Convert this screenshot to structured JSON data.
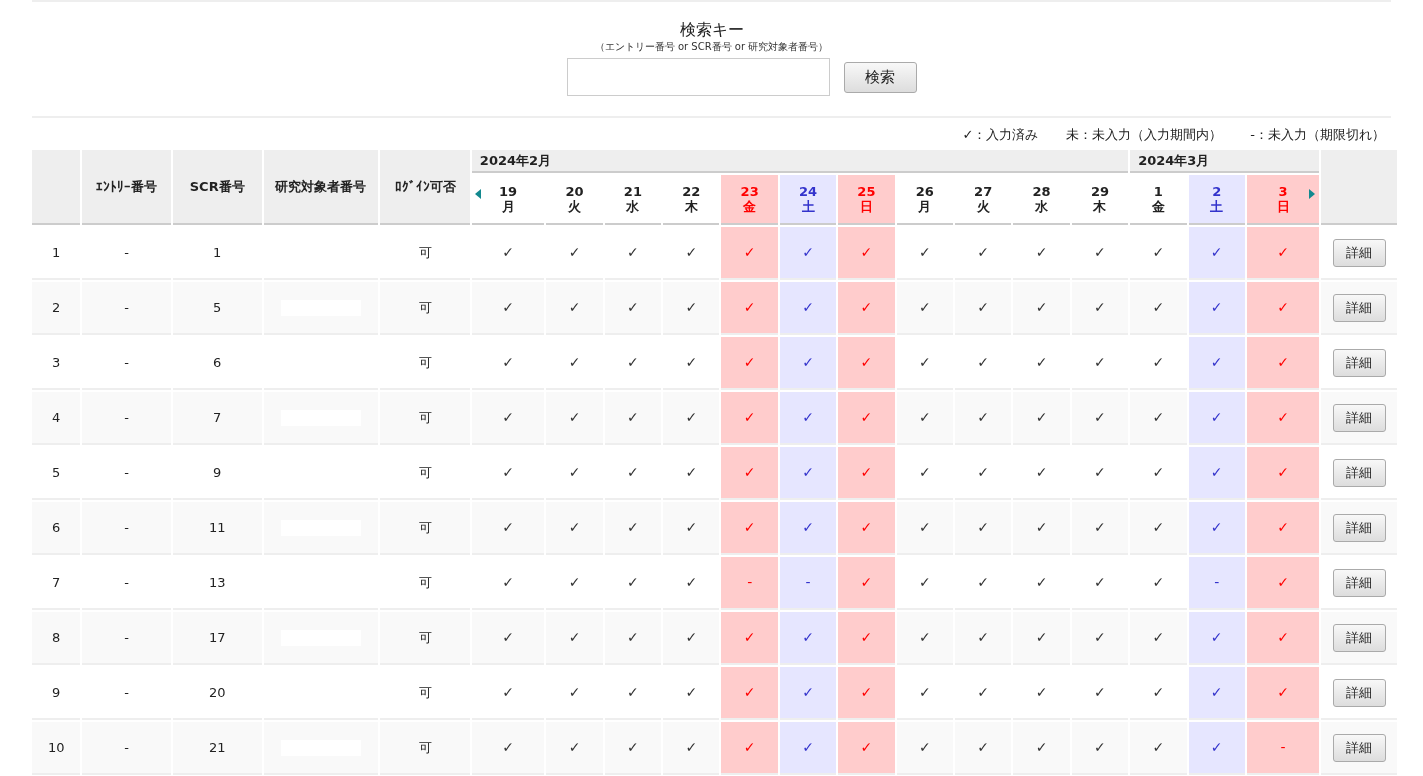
{
  "search": {
    "label": "検索キー",
    "hint": "（エントリー番号 or SCR番号 or 研究対象者番号）",
    "button": "検索"
  },
  "legend": [
    "✓：入力済み",
    "未：未入力（入力期間内）",
    "-：未入力（期限切れ）"
  ],
  "table": {
    "columns": [
      "ｴﾝﾄﾘｰ番号",
      "SCR番号",
      "研究対象者番号",
      "ﾛｸﾞｲﾝ可否"
    ],
    "months": [
      {
        "label": "2024年2月",
        "days": [
          {
            "day": "19",
            "weekday": "月",
            "kind": "weekday"
          },
          {
            "day": "20",
            "weekday": "火",
            "kind": "weekday"
          },
          {
            "day": "21",
            "weekday": "水",
            "kind": "weekday"
          },
          {
            "day": "22",
            "weekday": "木",
            "kind": "weekday"
          },
          {
            "day": "23",
            "weekday": "金",
            "kind": "holiday"
          },
          {
            "day": "24",
            "weekday": "土",
            "kind": "saturday"
          },
          {
            "day": "25",
            "weekday": "日",
            "kind": "holiday"
          },
          {
            "day": "26",
            "weekday": "月",
            "kind": "weekday"
          },
          {
            "day": "27",
            "weekday": "火",
            "kind": "weekday"
          },
          {
            "day": "28",
            "weekday": "水",
            "kind": "weekday"
          },
          {
            "day": "29",
            "weekday": "木",
            "kind": "weekday"
          }
        ]
      },
      {
        "label": "2024年3月",
        "days": [
          {
            "day": "1",
            "weekday": "金",
            "kind": "weekday"
          },
          {
            "day": "2",
            "weekday": "土",
            "kind": "saturday"
          },
          {
            "day": "3",
            "weekday": "日",
            "kind": "holiday"
          }
        ]
      }
    ],
    "rows": [
      {
        "no": "1",
        "entry": "-",
        "scr": "1",
        "redacted": false,
        "login": "可",
        "marks": [
          "✓",
          "✓",
          "✓",
          "✓",
          "✓",
          "✓",
          "✓",
          "✓",
          "✓",
          "✓",
          "✓",
          "✓",
          "✓",
          "✓"
        ],
        "action": "詳細"
      },
      {
        "no": "2",
        "entry": "-",
        "scr": "5",
        "redacted": true,
        "login": "可",
        "marks": [
          "✓",
          "✓",
          "✓",
          "✓",
          "✓",
          "✓",
          "✓",
          "✓",
          "✓",
          "✓",
          "✓",
          "✓",
          "✓",
          "✓"
        ],
        "action": "詳細"
      },
      {
        "no": "3",
        "entry": "-",
        "scr": "6",
        "redacted": false,
        "login": "可",
        "marks": [
          "✓",
          "✓",
          "✓",
          "✓",
          "✓",
          "✓",
          "✓",
          "✓",
          "✓",
          "✓",
          "✓",
          "✓",
          "✓",
          "✓"
        ],
        "action": "詳細"
      },
      {
        "no": "4",
        "entry": "-",
        "scr": "7",
        "redacted": true,
        "login": "可",
        "marks": [
          "✓",
          "✓",
          "✓",
          "✓",
          "✓",
          "✓",
          "✓",
          "✓",
          "✓",
          "✓",
          "✓",
          "✓",
          "✓",
          "✓"
        ],
        "action": "詳細"
      },
      {
        "no": "5",
        "entry": "-",
        "scr": "9",
        "redacted": false,
        "login": "可",
        "marks": [
          "✓",
          "✓",
          "✓",
          "✓",
          "✓",
          "✓",
          "✓",
          "✓",
          "✓",
          "✓",
          "✓",
          "✓",
          "✓",
          "✓"
        ],
        "action": "詳細"
      },
      {
        "no": "6",
        "entry": "-",
        "scr": "11",
        "redacted": true,
        "login": "可",
        "marks": [
          "✓",
          "✓",
          "✓",
          "✓",
          "✓",
          "✓",
          "✓",
          "✓",
          "✓",
          "✓",
          "✓",
          "✓",
          "✓",
          "✓"
        ],
        "action": "詳細"
      },
      {
        "no": "7",
        "entry": "-",
        "scr": "13",
        "redacted": false,
        "login": "可",
        "marks": [
          "✓",
          "✓",
          "✓",
          "✓",
          "-",
          "-",
          "✓",
          "✓",
          "✓",
          "✓",
          "✓",
          "✓",
          "-",
          "✓"
        ],
        "action": "詳細"
      },
      {
        "no": "8",
        "entry": "-",
        "scr": "17",
        "redacted": true,
        "login": "可",
        "marks": [
          "✓",
          "✓",
          "✓",
          "✓",
          "✓",
          "✓",
          "✓",
          "✓",
          "✓",
          "✓",
          "✓",
          "✓",
          "✓",
          "✓"
        ],
        "action": "詳細"
      },
      {
        "no": "9",
        "entry": "-",
        "scr": "20",
        "redacted": false,
        "login": "可",
        "marks": [
          "✓",
          "✓",
          "✓",
          "✓",
          "✓",
          "✓",
          "✓",
          "✓",
          "✓",
          "✓",
          "✓",
          "✓",
          "✓",
          "✓"
        ],
        "action": "詳細"
      },
      {
        "no": "10",
        "entry": "-",
        "scr": "21",
        "redacted": true,
        "login": "可",
        "marks": [
          "✓",
          "✓",
          "✓",
          "✓",
          "✓",
          "✓",
          "✓",
          "✓",
          "✓",
          "✓",
          "✓",
          "✓",
          "✓",
          "-"
        ],
        "action": "詳細"
      }
    ]
  }
}
